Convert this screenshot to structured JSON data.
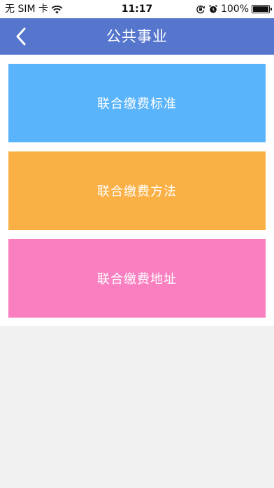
{
  "status_bar": {
    "carrier": "无 SIM 卡",
    "time": "11:17",
    "battery": "100%",
    "icons": [
      "wifi-icon",
      "orientation-lock-icon",
      "alarm-icon",
      "battery-icon"
    ]
  },
  "nav": {
    "back_icon": "chevron-left-icon",
    "title": "公共事业"
  },
  "cards": [
    {
      "label": "联合缴费标准",
      "color": "#5ab4fc"
    },
    {
      "label": "联合缴费方法",
      "color": "#fbb045"
    },
    {
      "label": "联合缴费地址",
      "color": "#fa7fc0"
    }
  ],
  "colors": {
    "nav_background": "#5576cc",
    "page_background": "#f1f1f1"
  }
}
